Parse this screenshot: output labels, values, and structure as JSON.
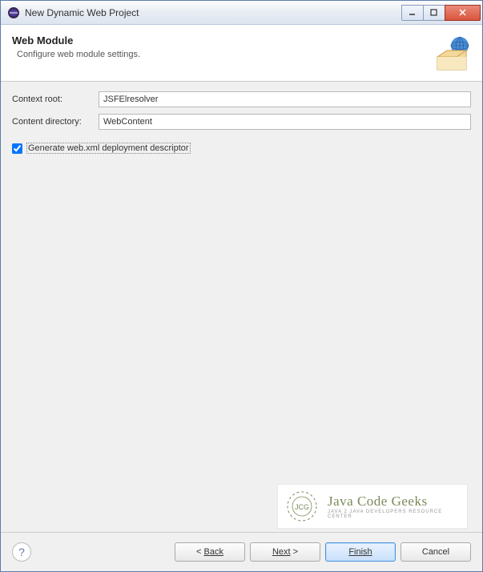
{
  "titlebar": {
    "title": "New Dynamic Web Project"
  },
  "header": {
    "title": "Web Module",
    "subtitle": "Configure web module settings."
  },
  "form": {
    "context_root_label": "Context root:",
    "context_root_value": "JSFElresolver",
    "content_dir_label": "Content directory:",
    "content_dir_value": "WebContent",
    "checkbox_label": "Generate web.xml deployment descriptor",
    "checkbox_checked": true
  },
  "watermark": {
    "title": "Java Code Geeks",
    "subtitle": "Java 2 Java Developers Resource Center"
  },
  "footer": {
    "back": "Back",
    "next": "Next",
    "finish": "Finish",
    "cancel": "Cancel"
  }
}
